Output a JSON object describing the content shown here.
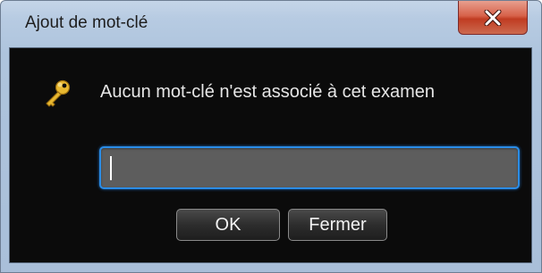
{
  "window": {
    "title": "Ajout de mot-clé",
    "close_icon": "close-x-icon"
  },
  "dialog": {
    "icon": "key-icon",
    "message": "Aucun mot-clé n'est associé à cet examen",
    "input": {
      "value": "",
      "placeholder": ""
    },
    "buttons": {
      "ok_label": "OK",
      "close_label": "Fermer"
    }
  },
  "colors": {
    "titlebar": "#b7cbe2",
    "content_bg": "#0b0b0b",
    "input_focus_border": "#2a8ce6",
    "close_button": "#c03c22",
    "key_gold": "#e8b830"
  }
}
